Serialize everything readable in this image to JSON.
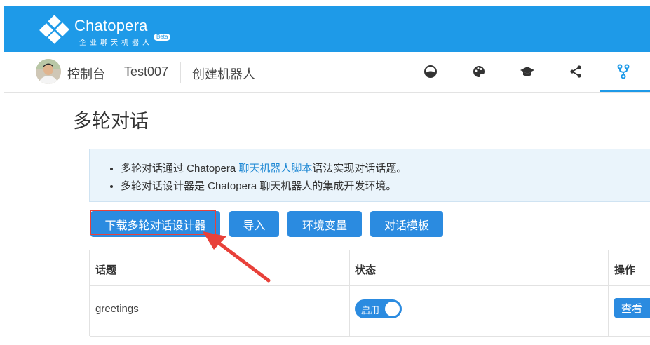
{
  "brand": {
    "name": "Chatopera",
    "subtitle": "企业聊天机器人",
    "badge": "Beta"
  },
  "nav": {
    "console_label": "控制台",
    "bot_name": "Test007",
    "create_label": "创建机器人",
    "icons": [
      "dashboard-icon",
      "palette-icon",
      "graduation-cap-icon",
      "share-icon",
      "flow-branch-icon"
    ],
    "active_icon": "flow-branch-icon"
  },
  "page": {
    "title": "多轮对话"
  },
  "info": {
    "line1_prefix": "多轮对话通过 Chatopera ",
    "line1_link": "聊天机器人脚本",
    "line1_suffix": "语法实现对话话题。",
    "line2": "多轮对话设计器是 Chatopera 聊天机器人的集成开发环境。"
  },
  "actions": {
    "download_label": "下载多轮对话设计器",
    "import_label": "导入",
    "env_label": "环境变量",
    "template_label": "对话模板"
  },
  "table": {
    "headers": [
      "话题",
      "状态",
      "操作"
    ],
    "rows": [
      {
        "topic": "greetings",
        "status_label": "启用",
        "enabled": true,
        "action_label": "查看"
      }
    ]
  },
  "colors": {
    "brand_blue": "#1e9ae8",
    "button_blue": "#2b8be0",
    "annotation_red": "#e8413a"
  }
}
